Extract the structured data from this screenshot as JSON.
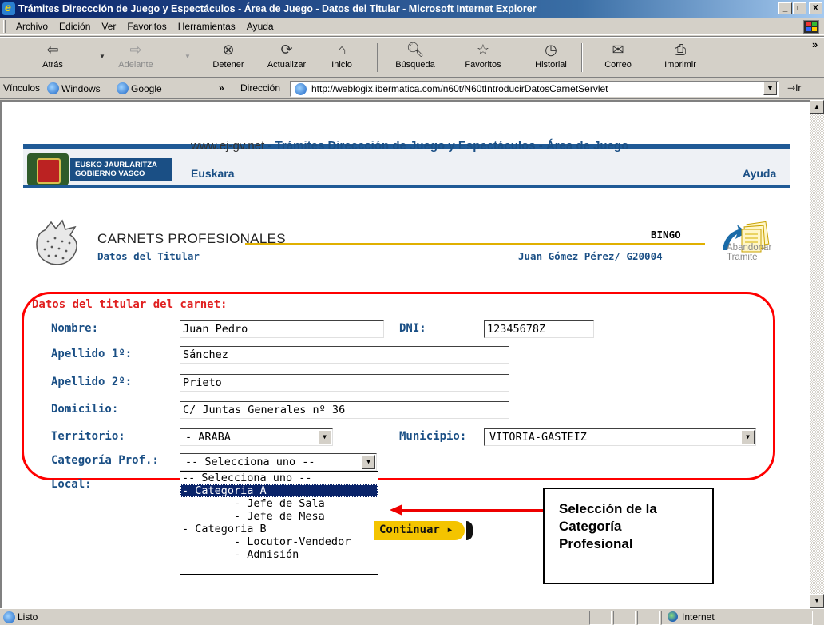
{
  "window": {
    "title": "Trámites Direccción de Juego y Espectáculos - Área de Juego - Datos del Titular - Microsoft Internet Explorer",
    "controls": {
      "minimize": "_",
      "maximize": "□",
      "close": "X"
    }
  },
  "menubar": {
    "items": [
      "Archivo",
      "Edición",
      "Ver",
      "Favoritos",
      "Herramientas",
      "Ayuda"
    ]
  },
  "toolbar": {
    "back": "Atrás",
    "forward": "Adelante",
    "stop": "Detener",
    "refresh": "Actualizar",
    "home": "Inicio",
    "search": "Búsqueda",
    "favorites": "Favoritos",
    "history": "Historial",
    "mail": "Correo",
    "print": "Imprimir",
    "more": "»"
  },
  "linksbar": {
    "label": "Vínculos",
    "links": [
      "Windows",
      "Google"
    ],
    "more": "»",
    "address_label": "Dirección",
    "url": "http://weblogix.ibermatica.com/n60t/N60tIntroducirDatosCarnetServlet",
    "go": "Ir"
  },
  "header": {
    "logo_line1": "EUSKO JAURLARITZA",
    "logo_line2": "GOBIERNO VASCO",
    "site_domain": "www.ej-gv.net",
    "site_title": " - Trámites Direccción de Juego y Espectáculos - Área de Juego",
    "lang_link": "Euskara",
    "help_link": "Ayuda"
  },
  "section": {
    "title": "CARNETS PROFESIONALES",
    "subtitle": "Datos del Titular",
    "game": "BINGO",
    "holder": "Juan Gómez Pérez/ G20004",
    "abandon_line1": "Abandonar",
    "abandon_line2": "Tramite"
  },
  "form": {
    "title": "Datos del titular del carnet:",
    "nombre_label": "Nombre:",
    "nombre": "Juan Pedro",
    "dni_label": "DNI:",
    "dni": "12345678Z",
    "apellido1_label": "Apellido 1º:",
    "apellido1": "Sánchez",
    "apellido2_label": "Apellido 2º:",
    "apellido2": "Prieto",
    "domicilio_label": "Domicilio:",
    "domicilio": "C/ Juntas Generales nº 36",
    "territorio_label": "Territorio:",
    "territorio": " - ARABA",
    "municipio_label": "Municipio:",
    "municipio": "VITORIA-GASTEIZ",
    "categoria_label": "Categoría Prof.:",
    "categoria": "-- Selecciona uno --",
    "local_label": "Local:",
    "categoria_options": [
      "-- Selecciona uno --",
      "- Categoria A",
      "        - Jefe de Sala",
      "        - Jefe de Mesa",
      "- Categoria B",
      "        - Locutor-Vendedor",
      "        - Admisión"
    ],
    "selected_option_index": 1,
    "continue_button": "Continuar ▸"
  },
  "annotation": {
    "line1": "Selección de la",
    "line2": "Categoría",
    "line3": "Profesional"
  },
  "status": {
    "text": "Listo",
    "zone": "Internet"
  },
  "colors": {
    "accent_blue": "#1a4f85",
    "alert_red": "#ff0000",
    "gold": "#f4c400"
  }
}
